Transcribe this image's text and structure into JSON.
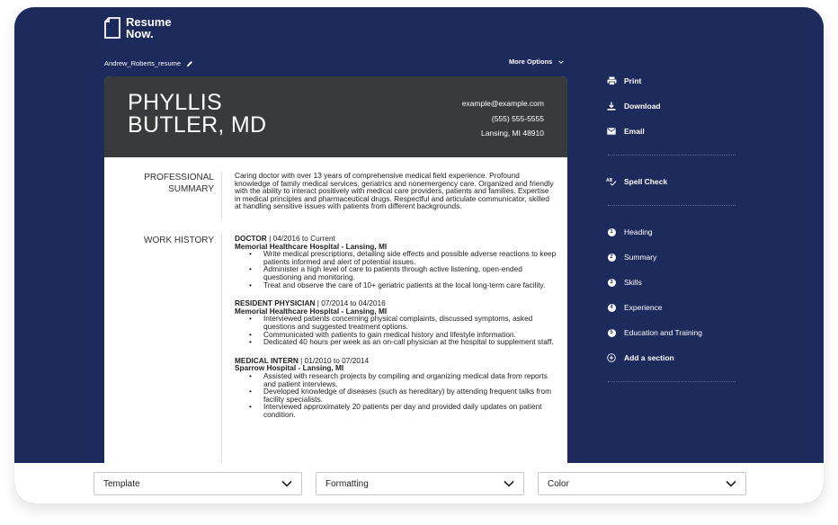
{
  "brand": {
    "logo_line1": "Resume",
    "logo_line2": "Now."
  },
  "document": {
    "filename": "Andrew_Roberts_resume",
    "more_options": "More Options"
  },
  "resume": {
    "name_line1": "PHYLLIS",
    "name_line2": "BUTLER, MD",
    "email": "example@example.com",
    "phone": "(555) 555-5555",
    "location": "Lansing, MI 48910",
    "summary_title_line1": "PROFESSIONAL",
    "summary_title_line2": "SUMMARY",
    "summary_text": "Caring doctor with over 13 years of comprehensive medical field experience. Profound knowledge of family medical services, geriatrics and nonemergency care. Organized and friendly with the ability to interact positively with medical care providers, patients and families. Expertise in medical principles and pharmaceutical drugs. Respectful and articulate communicator, skilled at handling sensitive issues with patients from different backgrounds.",
    "work_title": "WORK HISTORY",
    "jobs": [
      {
        "role": "DOCTOR",
        "dates": " | 04/2016 to Current",
        "company": "Memorial Healthcare Hospital - Lansing, MI",
        "bullets": [
          "Write medical prescriptions, detailing side effects and possible adverse reactions to keep patients informed and alert of potential issues.",
          "Administer a high level of care to patients through active listening, open-ended questioning and monitoring.",
          "Treat and observe the care of 10+ geriatric patients at the local long-term care facility."
        ]
      },
      {
        "role": "RESIDENT PHYSICIAN",
        "dates": " | 07/2014 to 04/2016",
        "company": "Memorial Healthcare Hospital - Lansing, MI",
        "bullets": [
          "Interviewed patients concerning physical complaints, discussed symptoms, asked questions and suggested treatment options.",
          "Communicated with patients to gain medical history and lifestyle information.",
          "Dedicated 40 hours per week as an on-call physician at the hospital to supplement staff."
        ]
      },
      {
        "role": "MEDICAL INTERN",
        "dates": " | 01/2010 to 07/2014",
        "company": "Sparrow Hospital - Lansing, MI",
        "bullets": [
          "Assisted with research projects by compiling and organizing medical data from reports and patient interviews.",
          "Developed knowledge of diseases (such as hereditary) by attending frequent talks from facility specialists.",
          "Interviewed approximately 20 patients per day and provided daily updates on patient condition."
        ]
      }
    ]
  },
  "actions": {
    "print": "Print",
    "download": "Download",
    "email": "Email",
    "spell_check": "Spell Check"
  },
  "sections_nav": {
    "items": [
      {
        "num": "1",
        "label": "Heading"
      },
      {
        "num": "2",
        "label": "Summary"
      },
      {
        "num": "3",
        "label": "Skills"
      },
      {
        "num": "4",
        "label": "Experience"
      },
      {
        "num": "5",
        "label": "Education and Training"
      }
    ],
    "add_section": "Add a section"
  },
  "toolbar": {
    "template": "Template",
    "formatting": "Formatting",
    "color": "Color"
  },
  "colors": {
    "navy": "#1d2a5c",
    "resume_header": "#383a3c"
  }
}
